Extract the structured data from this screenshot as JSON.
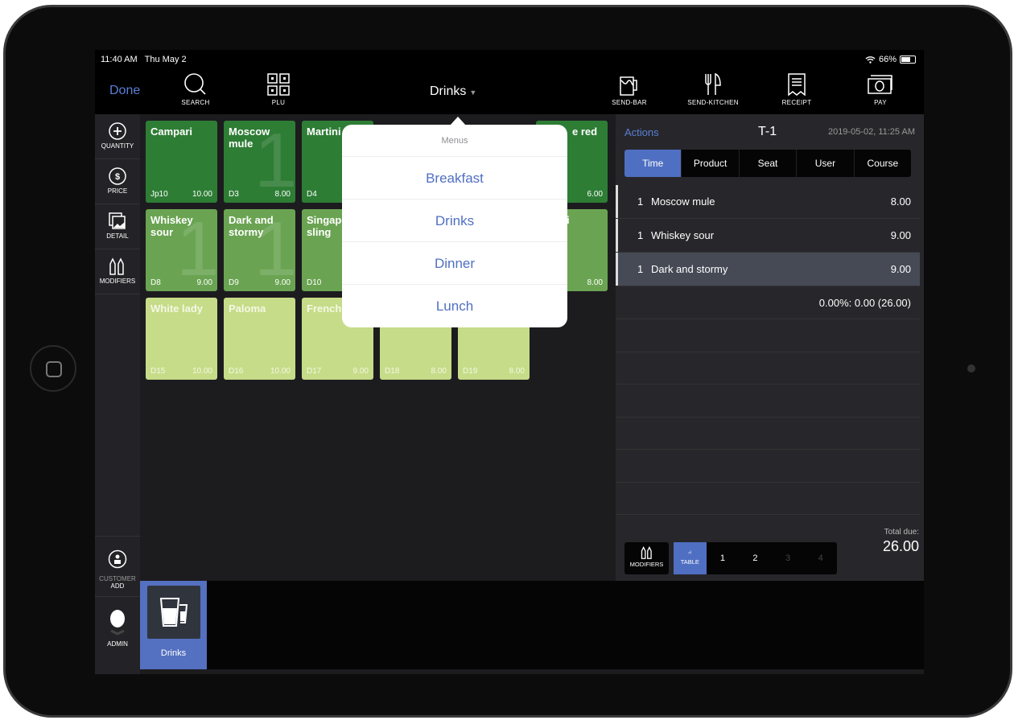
{
  "status": {
    "time": "11:40 AM",
    "date": "Thu May 2",
    "battery": "66%",
    "battery_level": 0.66
  },
  "topbar": {
    "done": "Done",
    "search": "SEARCH",
    "plu": "PLU",
    "menu": "Drinks",
    "send_bar": "SEND-BAR",
    "send_kitchen": "SEND-KITCHEN",
    "receipt": "RECEIPT",
    "pay": "PAY"
  },
  "sidebar": {
    "quantity": "QUANTITY",
    "price": "PRICE",
    "detail": "DETAIL",
    "modifiers": "MODIFIERS",
    "customer": "CUSTOMER",
    "add": "ADD",
    "admin": "ADMIN"
  },
  "tiles": [
    {
      "name": "Campari",
      "code": "Jp10",
      "price": "10.00",
      "count": ""
    },
    {
      "name": "Moscow mule",
      "code": "D3",
      "price": "8.00",
      "count": "1"
    },
    {
      "name": "Martini",
      "code": "D4",
      "price": "",
      "count": ""
    },
    {
      "name": "e red",
      "code": "",
      "price": "6.00",
      "count": ""
    },
    {
      "name": "Whiskey sour",
      "code": "D8",
      "price": "9.00",
      "count": "1"
    },
    {
      "name": "Dark and stormy",
      "code": "D9",
      "price": "9.00",
      "count": "1"
    },
    {
      "name": "Singapore sling",
      "code": "D10",
      "price": "",
      "count": ""
    },
    {
      "name": "i",
      "code": "",
      "price": "8.00",
      "count": ""
    },
    {
      "name": "White lady",
      "code": "D15",
      "price": "10.00",
      "count": ""
    },
    {
      "name": "Paloma",
      "code": "D16",
      "price": "10.00",
      "count": ""
    },
    {
      "name": "French",
      "code": "D17",
      "price": "9.00",
      "count": ""
    },
    {
      "name": "",
      "code": "D18",
      "price": "8.00",
      "count": ""
    },
    {
      "name": "",
      "code": "D19",
      "price": "8.00",
      "count": ""
    }
  ],
  "popover": {
    "header": "Menus",
    "items": [
      "Breakfast",
      "Drinks",
      "Dinner",
      "Lunch"
    ]
  },
  "order": {
    "actions": "Actions",
    "table": "T-1",
    "datetime": "2019-05-02, 11:25 AM",
    "tabs": [
      "Time",
      "Product",
      "Seat",
      "User",
      "Course"
    ],
    "items": [
      {
        "qty": "1",
        "name": "Moscow mule",
        "price": "8.00"
      },
      {
        "qty": "1",
        "name": "Whiskey sour",
        "price": "9.00"
      },
      {
        "qty": "1",
        "name": "Dark and stormy",
        "price": "9.00"
      }
    ],
    "summary": "0.00%: 0.00 (26.00)",
    "modifiers": "MODIFIERS",
    "table_label": "TABLE",
    "seats": [
      "1",
      "2",
      "3",
      "4"
    ],
    "total_label": "Total due:",
    "total": "26.00"
  },
  "category": {
    "label": "Drinks"
  },
  "colors": {
    "accent": "#4f6fc2",
    "tile_dark": "#2e7d35",
    "tile_mid": "#6aa452",
    "tile_light": "#c6dc88"
  }
}
